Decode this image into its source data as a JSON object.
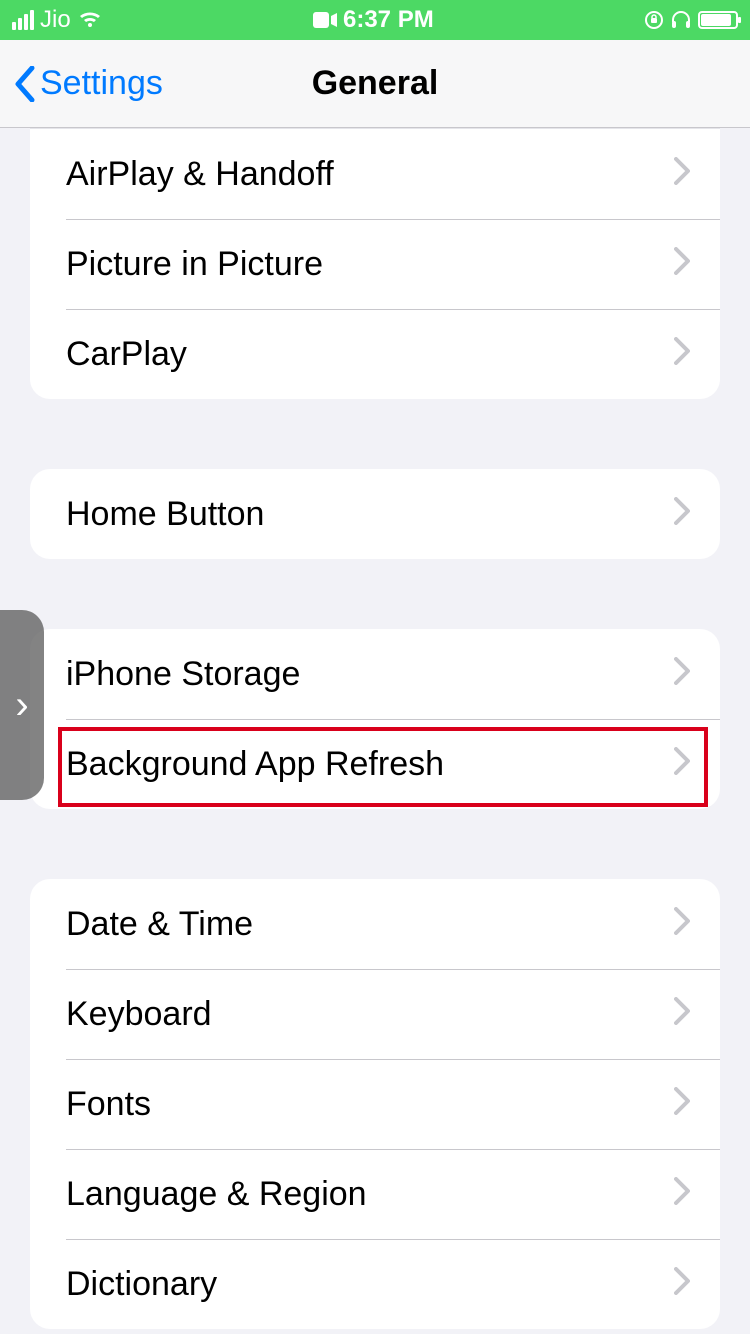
{
  "status": {
    "carrier": "Jio",
    "time": "6:37 PM"
  },
  "nav": {
    "back_label": "Settings",
    "title": "General"
  },
  "groups": [
    {
      "items": [
        {
          "id": "airplay-handoff",
          "label": "AirPlay & Handoff"
        },
        {
          "id": "picture-in-picture",
          "label": "Picture in Picture"
        },
        {
          "id": "carplay",
          "label": "CarPlay"
        }
      ]
    },
    {
      "items": [
        {
          "id": "home-button",
          "label": "Home Button"
        }
      ]
    },
    {
      "items": [
        {
          "id": "iphone-storage",
          "label": "iPhone Storage"
        },
        {
          "id": "background-app-refresh",
          "label": "Background App Refresh",
          "highlighted": true
        }
      ]
    },
    {
      "items": [
        {
          "id": "date-time",
          "label": "Date & Time"
        },
        {
          "id": "keyboard",
          "label": "Keyboard"
        },
        {
          "id": "fonts",
          "label": "Fonts"
        },
        {
          "id": "language-region",
          "label": "Language & Region"
        },
        {
          "id": "dictionary",
          "label": "Dictionary"
        }
      ]
    }
  ]
}
